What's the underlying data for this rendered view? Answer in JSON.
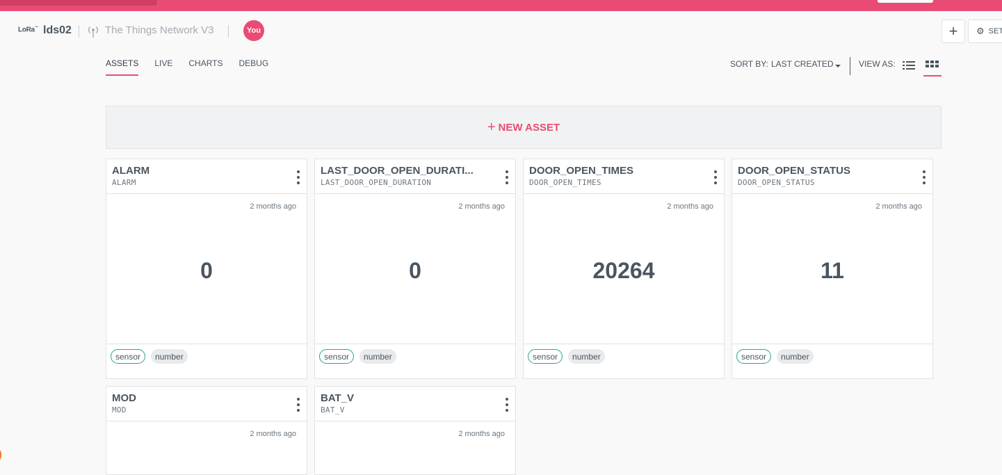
{
  "device": {
    "logo_text": "LoRa",
    "logo_mark": "™",
    "name": "lds02",
    "network_icon": "antenna-icon",
    "network": "The Things Network V3",
    "owner": "You"
  },
  "actions": {
    "add_icon": "plus-icon",
    "settings_icon": "gear-icon",
    "settings_label": "SET"
  },
  "tabs": [
    {
      "label": "ASSETS",
      "active": true
    },
    {
      "label": "LIVE",
      "active": false
    },
    {
      "label": "CHARTS",
      "active": false
    },
    {
      "label": "DEBUG",
      "active": false
    }
  ],
  "sort": {
    "label": "SORT BY:",
    "value": "LAST CREATED"
  },
  "view": {
    "label": "VIEW AS:",
    "options": [
      "list-view-icon",
      "grid-view-icon"
    ],
    "selected": "grid"
  },
  "new_asset": {
    "icon": "+",
    "label": "NEW ASSET"
  },
  "colors": {
    "accent": "#ea4b74",
    "sensor_tag_border": "#2aa198"
  },
  "assets": [
    {
      "title": "ALARM",
      "key": "ALARM",
      "time": "2 months ago",
      "value": "0",
      "tags": [
        "sensor",
        "number"
      ]
    },
    {
      "title": "LAST_DOOR_OPEN_DURATI...",
      "key": "LAST_DOOR_OPEN_DURATION",
      "time": "2 months ago",
      "value": "0",
      "tags": [
        "sensor",
        "number"
      ]
    },
    {
      "title": "DOOR_OPEN_TIMES",
      "key": "DOOR_OPEN_TIMES",
      "time": "2 months ago",
      "value": "20264",
      "tags": [
        "sensor",
        "number"
      ]
    },
    {
      "title": "DOOR_OPEN_STATUS",
      "key": "DOOR_OPEN_STATUS",
      "time": "2 months ago",
      "value": "11",
      "tags": [
        "sensor",
        "number"
      ]
    },
    {
      "title": "MOD",
      "key": "MOD",
      "time": "2 months ago",
      "value": "",
      "tags": []
    },
    {
      "title": "BAT_V",
      "key": "BAT_V",
      "time": "2 months ago",
      "value": "",
      "tags": []
    }
  ]
}
